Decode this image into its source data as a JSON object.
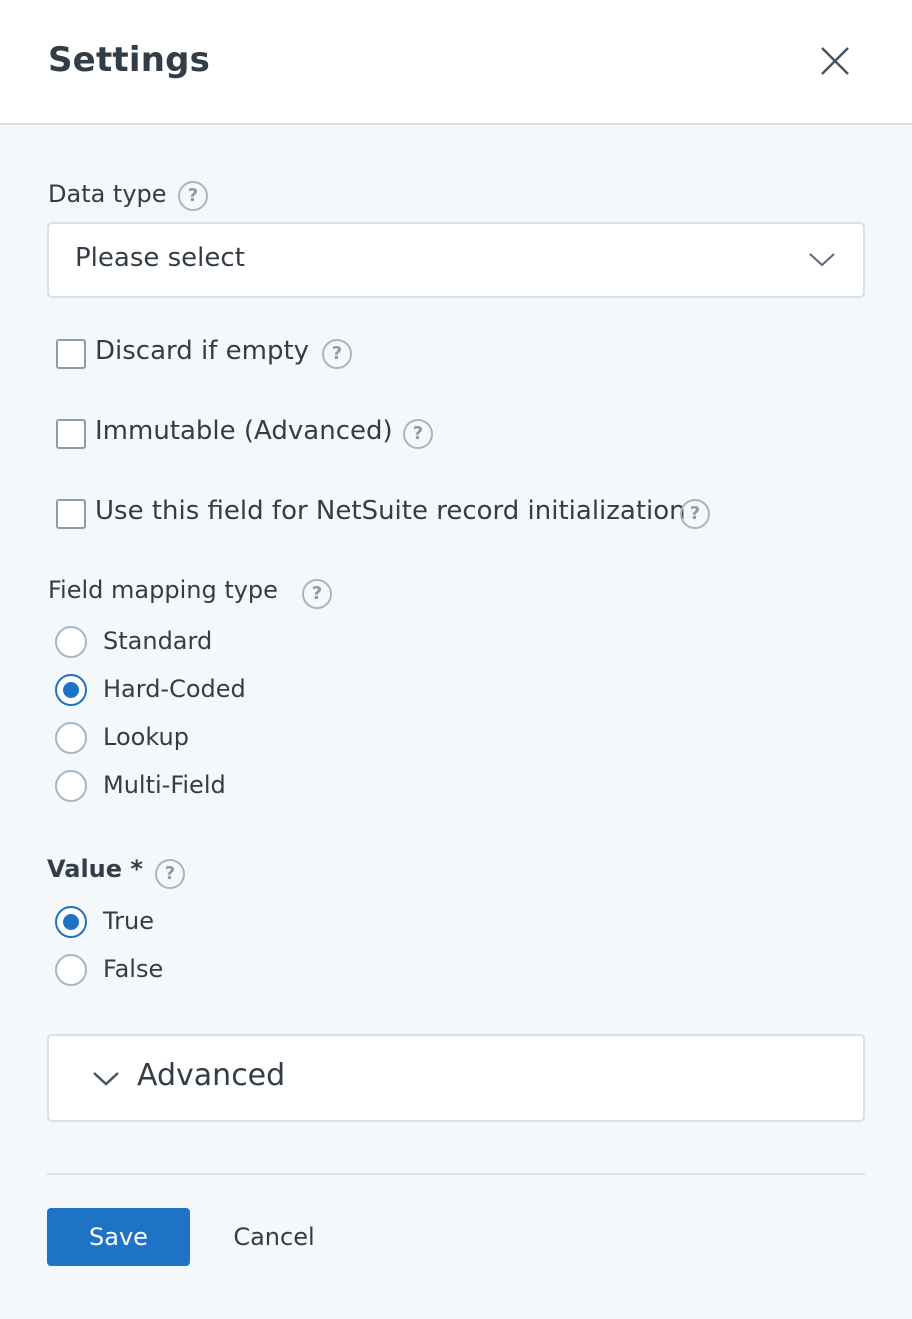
{
  "dialog": {
    "title": "Settings",
    "close_icon": "close-icon"
  },
  "data_type": {
    "label": "Data type",
    "value": "Please select",
    "help_icon": "?"
  },
  "checkboxes": [
    {
      "label": "Discard if empty",
      "checked": false,
      "help_icon": "?"
    },
    {
      "label": "Immutable (Advanced)",
      "checked": false,
      "help_icon": "?"
    },
    {
      "label": "Use this field for NetSuite record initialization",
      "checked": false,
      "help_icon": "?"
    }
  ],
  "field_mapping": {
    "label": "Field mapping type",
    "help_icon": "?",
    "options": [
      {
        "label": "Standard",
        "selected": false
      },
      {
        "label": "Hard-Coded",
        "selected": true
      },
      {
        "label": "Lookup",
        "selected": false
      },
      {
        "label": "Multi-Field",
        "selected": false
      }
    ]
  },
  "value": {
    "label": "Value *",
    "help_icon": "?",
    "options": [
      {
        "label": "True",
        "selected": true
      },
      {
        "label": "False",
        "selected": false
      }
    ]
  },
  "advanced": {
    "label": "Advanced"
  },
  "footer": {
    "save_label": "Save",
    "cancel_label": "Cancel"
  },
  "colors": {
    "accent": "#1e73c6",
    "background": "#f5f8fb",
    "text": "#333d47",
    "border": "#d8e1e8"
  }
}
